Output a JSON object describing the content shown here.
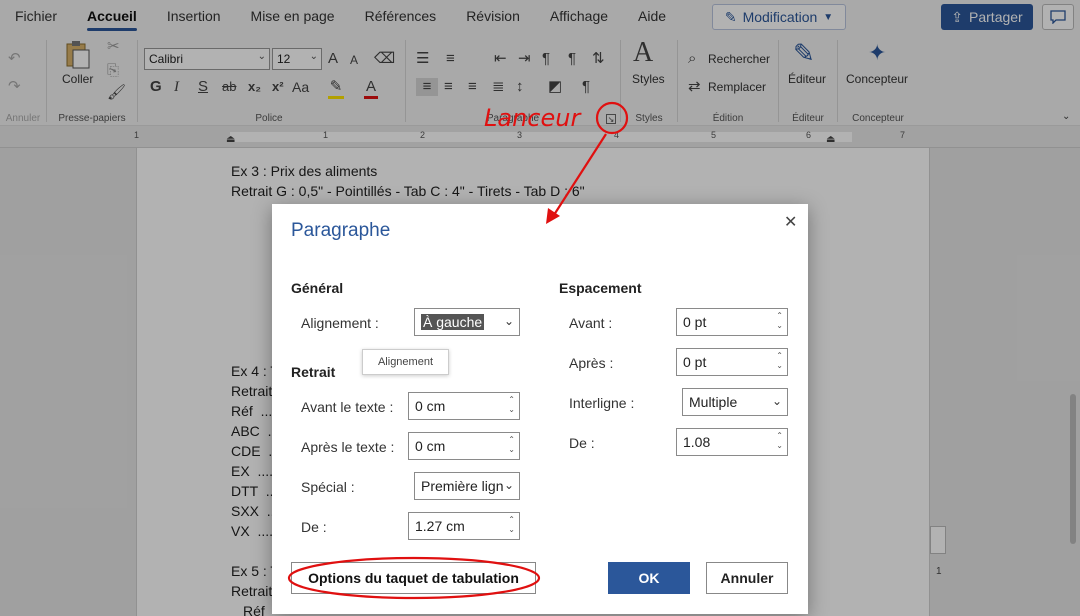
{
  "menu": {
    "tabs": [
      "Fichier",
      "Accueil",
      "Insertion",
      "Mise en page",
      "Références",
      "Révision",
      "Affichage",
      "Aide"
    ],
    "active_tab": "Accueil",
    "mode_label": "Modification",
    "share_label": "Partager"
  },
  "ribbon": {
    "undo_group": "Annuler",
    "clipboard": {
      "paste_label": "Coller",
      "group": "Presse-papiers"
    },
    "font": {
      "name": "Calibri",
      "size": "12",
      "group": "Police",
      "bold": "G",
      "italic": "I",
      "underline": "S",
      "strike": "ab",
      "subscript": "x₂",
      "superscript": "x²",
      "case": "Aa",
      "color_letter": "A",
      "grow": "A",
      "shrink": "A"
    },
    "paragraph": {
      "group": "Paragraphe"
    },
    "styles": {
      "label": "Styles",
      "group": "Styles"
    },
    "editing": {
      "find": "Rechercher",
      "replace": "Remplacer",
      "group": "Édition"
    },
    "editor": {
      "label": "Éditeur",
      "group": "Éditeur"
    },
    "designer": {
      "label": "Concepteur",
      "group": "Concepteur"
    }
  },
  "ruler": {
    "numbers": [
      "1",
      "1",
      "2",
      "3",
      "4",
      "5",
      "6",
      "7"
    ]
  },
  "document": {
    "lines_top": [
      "Ex 3 : Prix des aliments",
      "Retrait G : 0,5\" - Pointillés - Tab C : 4\" - Tirets - Tab D : 6\""
    ],
    "lines_mid": [
      "Ex 4 : T",
      "Retrait",
      "Réf  ...",
      "ABC  ...",
      "CDE  ...",
      "EX  ....",
      "DTT  ...",
      "SXX  ...",
      "VX  ...."
    ],
    "lines_bottom": [
      "Ex 5 : T",
      "Retrait",
      "Réf"
    ]
  },
  "annotation": {
    "text": "Lanceur",
    "color": "#e01010"
  },
  "dialog": {
    "title": "Paragraphe",
    "general": {
      "heading": "Général",
      "alignment_label": "Alignement :",
      "alignment_value": "À gauche",
      "tooltip": "Alignement"
    },
    "indent": {
      "heading": "Retrait",
      "before_label": "Avant le texte :",
      "before_value": "0 cm",
      "after_label": "Après le texte :",
      "after_value": "0 cm",
      "special_label": "Spécial :",
      "special_value": "Première ligne",
      "by_label": "De :",
      "by_value": "1.27 cm"
    },
    "spacing": {
      "heading": "Espacement",
      "before_label": "Avant :",
      "before_value": "0 pt",
      "after_label": "Après :",
      "after_value": "0 pt",
      "line_label": "Interligne :",
      "line_value": "Multiple",
      "at_label": "De :",
      "at_value": "1.08"
    },
    "tabs_button": "Options du taquet de tabulation",
    "ok": "OK",
    "cancel": "Annuler"
  },
  "side_page_number": "1",
  "colors": {
    "accent": "#2b579a",
    "annotation_red": "#e01010"
  }
}
